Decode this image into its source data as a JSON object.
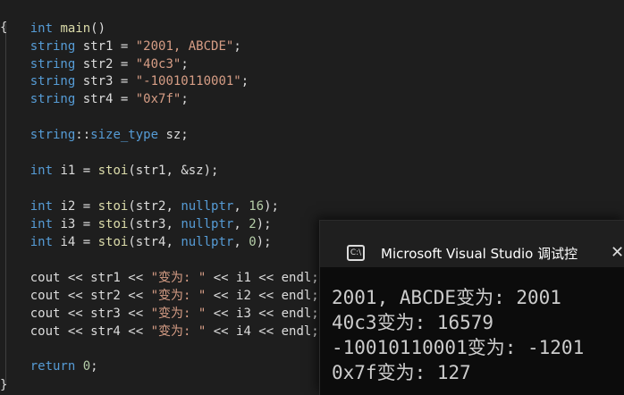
{
  "editor": {
    "lines": [
      {
        "t1": "int",
        "t2": " ",
        "t3": "main",
        "t4": "()"
      },
      {
        "text": "{"
      },
      {
        "indent": "    ",
        "type": "string",
        "rest": " str1 = ",
        "val": "\"2001, ABCDE\"",
        "end": ";"
      },
      {
        "indent": "    ",
        "type": "string",
        "rest": " str2 = ",
        "val": "\"40c3\"",
        "end": ";"
      },
      {
        "indent": "    ",
        "type": "string",
        "rest": " str3 = ",
        "val": "\"-10010110001\"",
        "end": ";"
      },
      {
        "indent": "    ",
        "type": "string",
        "rest": " str4 = ",
        "val": "\"0x7f\"",
        "end": ";"
      },
      {
        "indent": "    ",
        "type": "string",
        "sep": "::",
        "sub": "size_type",
        "rest": " sz;"
      },
      {
        "indent": "    ",
        "kw": "int",
        "rest1": " i1 = ",
        "fn": "stoi",
        "rest2": "(str1, &sz);"
      },
      {
        "indent": "    ",
        "kw": "int",
        "rest1": " i2 = ",
        "fn": "stoi",
        "rest2": "(str2, ",
        "kw2": "nullptr",
        "rest3": ", ",
        "num": "16",
        "end": ");"
      },
      {
        "indent": "    ",
        "kw": "int",
        "rest1": " i3 = ",
        "fn": "stoi",
        "rest2": "(str3, ",
        "kw2": "nullptr",
        "rest3": ", ",
        "num": "2",
        "end": ");"
      },
      {
        "indent": "    ",
        "kw": "int",
        "rest1": " i4 = ",
        "fn": "stoi",
        "rest2": "(str4, ",
        "kw2": "nullptr",
        "rest3": ", ",
        "num": "0",
        "end": ");"
      },
      {
        "indent": "    ",
        "a": "cout << str1 << ",
        "s": "\"变为: \"",
        "b": " << i1 << endl;"
      },
      {
        "indent": "    ",
        "a": "cout << str2 << ",
        "s": "\"变为: \"",
        "b": " << i2 << endl;"
      },
      {
        "indent": "    ",
        "a": "cout << str3 << ",
        "s": "\"变为: \"",
        "b": " << i3 << endl;"
      },
      {
        "indent": "    ",
        "a": "cout << str4 << ",
        "s": "\"变为: \"",
        "b": " << i4 << endl;"
      },
      {
        "indent": "    ",
        "kw": "return",
        "rest1": " ",
        "num": "0",
        "end": ";"
      },
      {
        "text": "}"
      }
    ]
  },
  "console": {
    "title": "Microsoft Visual Studio 调试控",
    "icon": "console-app-icon",
    "icon_label": "C:\\",
    "close": "✕",
    "output": [
      "2001, ABCDE变为: 2001",
      "40c3变为: 16579",
      "-10010110001变为: -1201",
      "0x7f变为: 127"
    ]
  }
}
